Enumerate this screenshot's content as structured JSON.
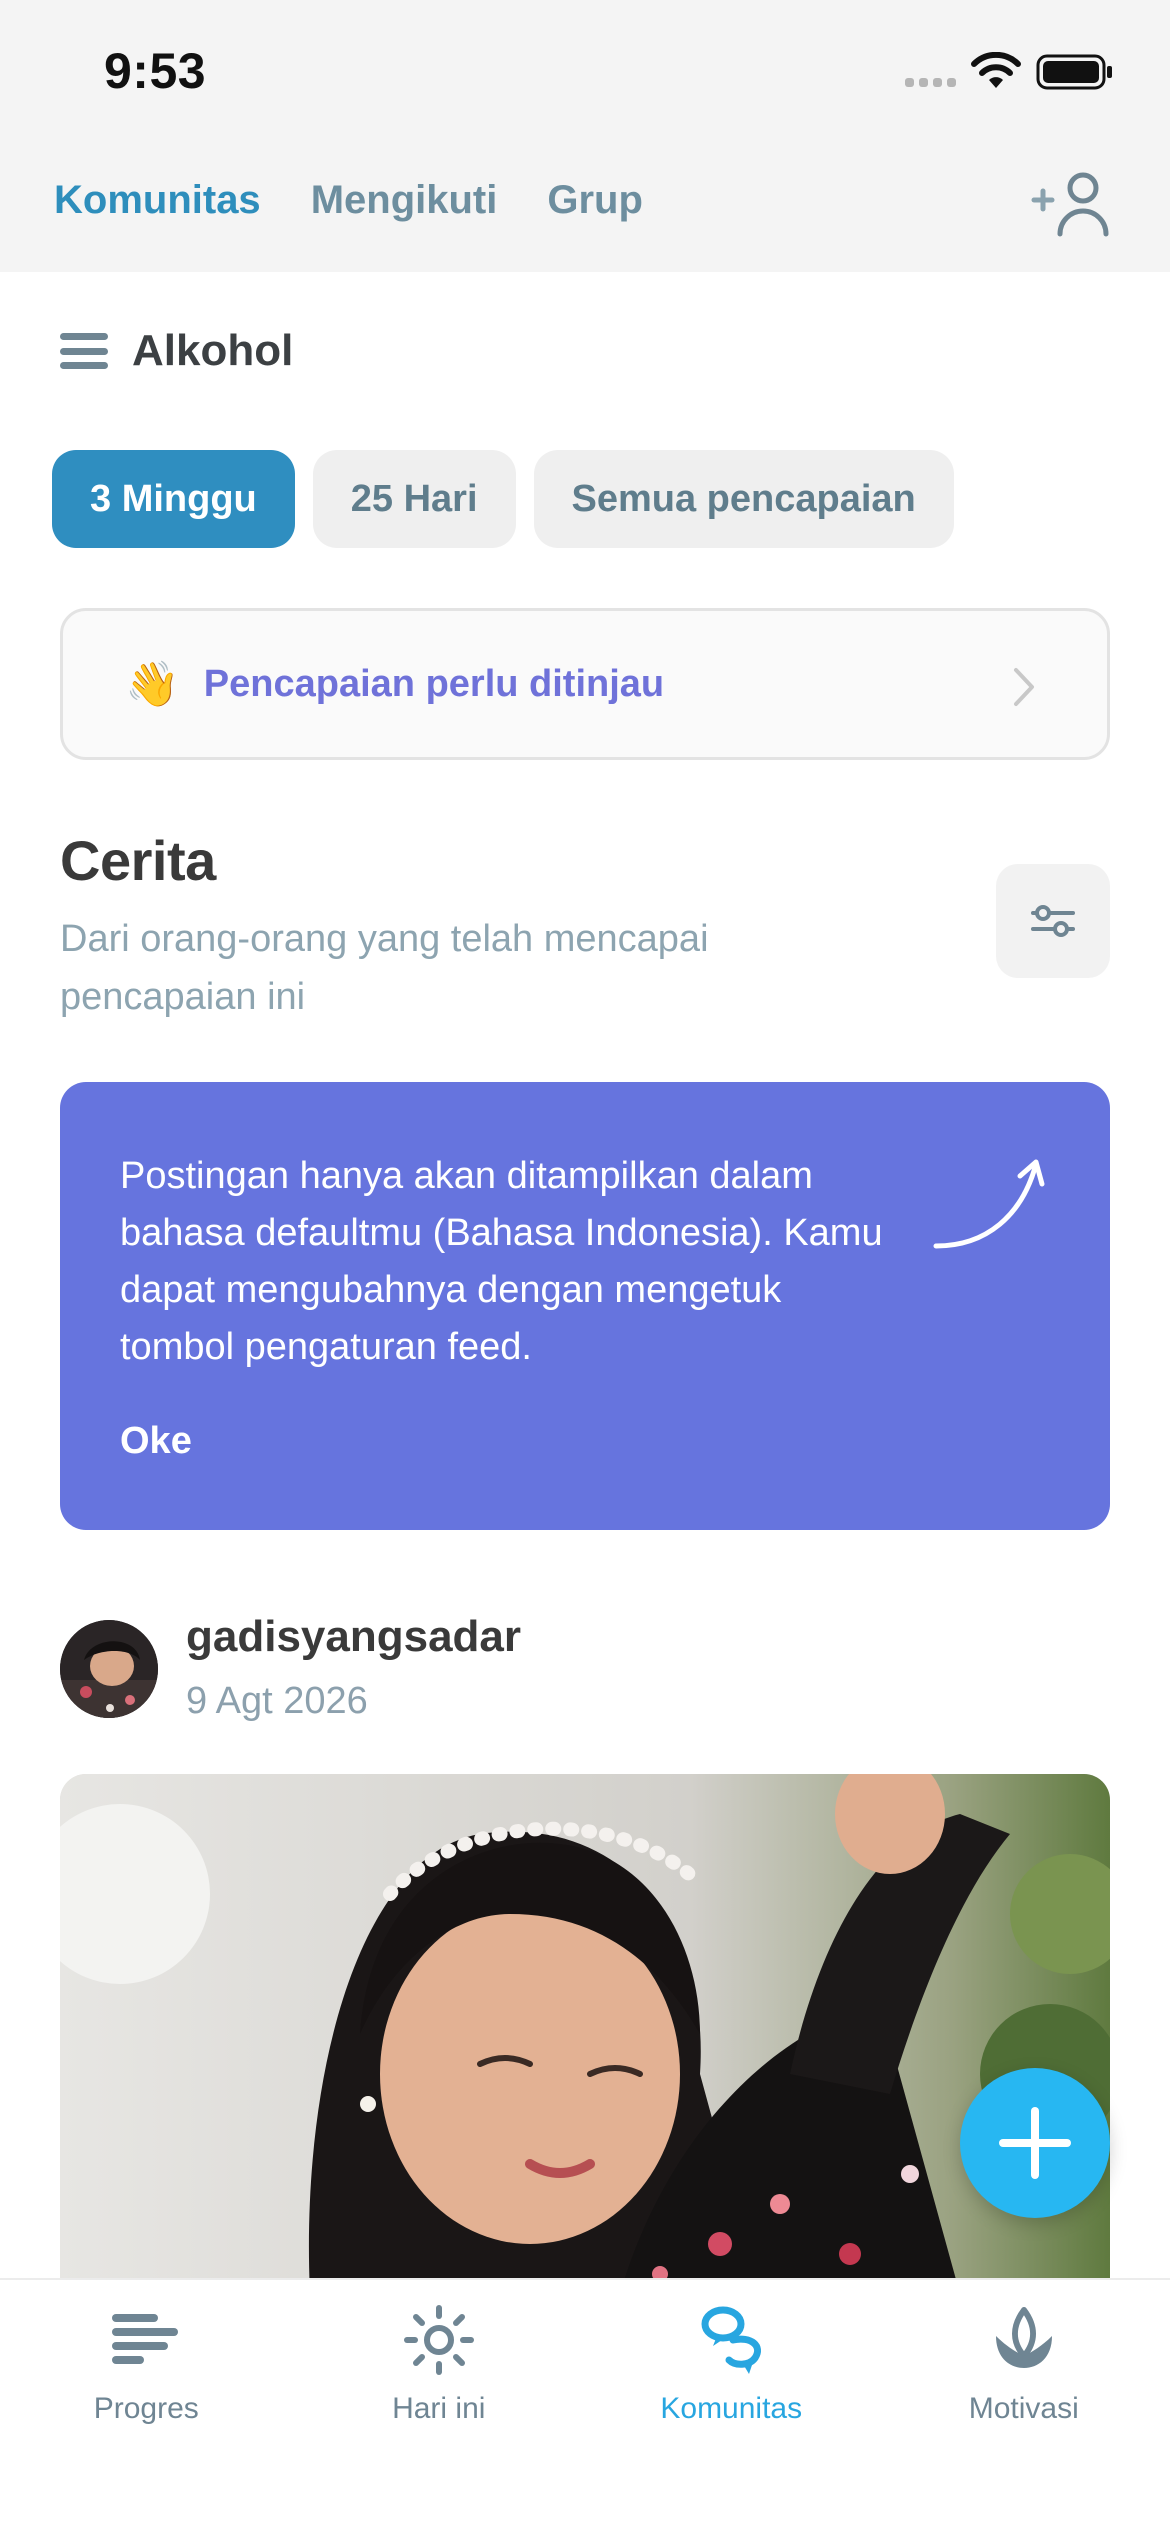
{
  "status_bar": {
    "time": "9:53"
  },
  "top_tabs": [
    {
      "label": "Komunitas",
      "active": true
    },
    {
      "label": "Mengikuti",
      "active": false
    },
    {
      "label": "Grup",
      "active": false
    }
  ],
  "header": {
    "title": "Alkohol"
  },
  "chips": [
    {
      "label": "3 Minggu",
      "active": true
    },
    {
      "label": "25 Hari",
      "active": false
    },
    {
      "label": "Semua pencapaian",
      "active": false
    }
  ],
  "review_banner": {
    "emoji": "👋",
    "label": "Pencapaian perlu ditinjau"
  },
  "stories": {
    "title": "Cerita",
    "subtitle": "Dari orang-orang yang telah mencapai pencapaian ini"
  },
  "info_card": {
    "text": "Postingan hanya akan ditampilkan dalam bahasa defaultmu (Bahasa Indonesia). Kamu dapat mengubahnya dengan mengetuk tombol pengaturan feed.",
    "ok_label": "Oke"
  },
  "post": {
    "username": "gadisyangsadar",
    "date": "9 Agt 2026"
  },
  "bottom_nav": [
    {
      "label": "Progres",
      "icon": "progress-bars-icon",
      "active": false
    },
    {
      "label": "Hari ini",
      "icon": "sun-icon",
      "active": false
    },
    {
      "label": "Komunitas",
      "icon": "community-icon",
      "active": true
    },
    {
      "label": "Motivasi",
      "icon": "lotus-icon",
      "active": false
    }
  ],
  "colors": {
    "primary": "#2f8ec0",
    "accent_purple": "#6674de",
    "fab": "#27b7f2",
    "active_nav": "#28a6e0",
    "muted_text": "#8da4b0"
  }
}
